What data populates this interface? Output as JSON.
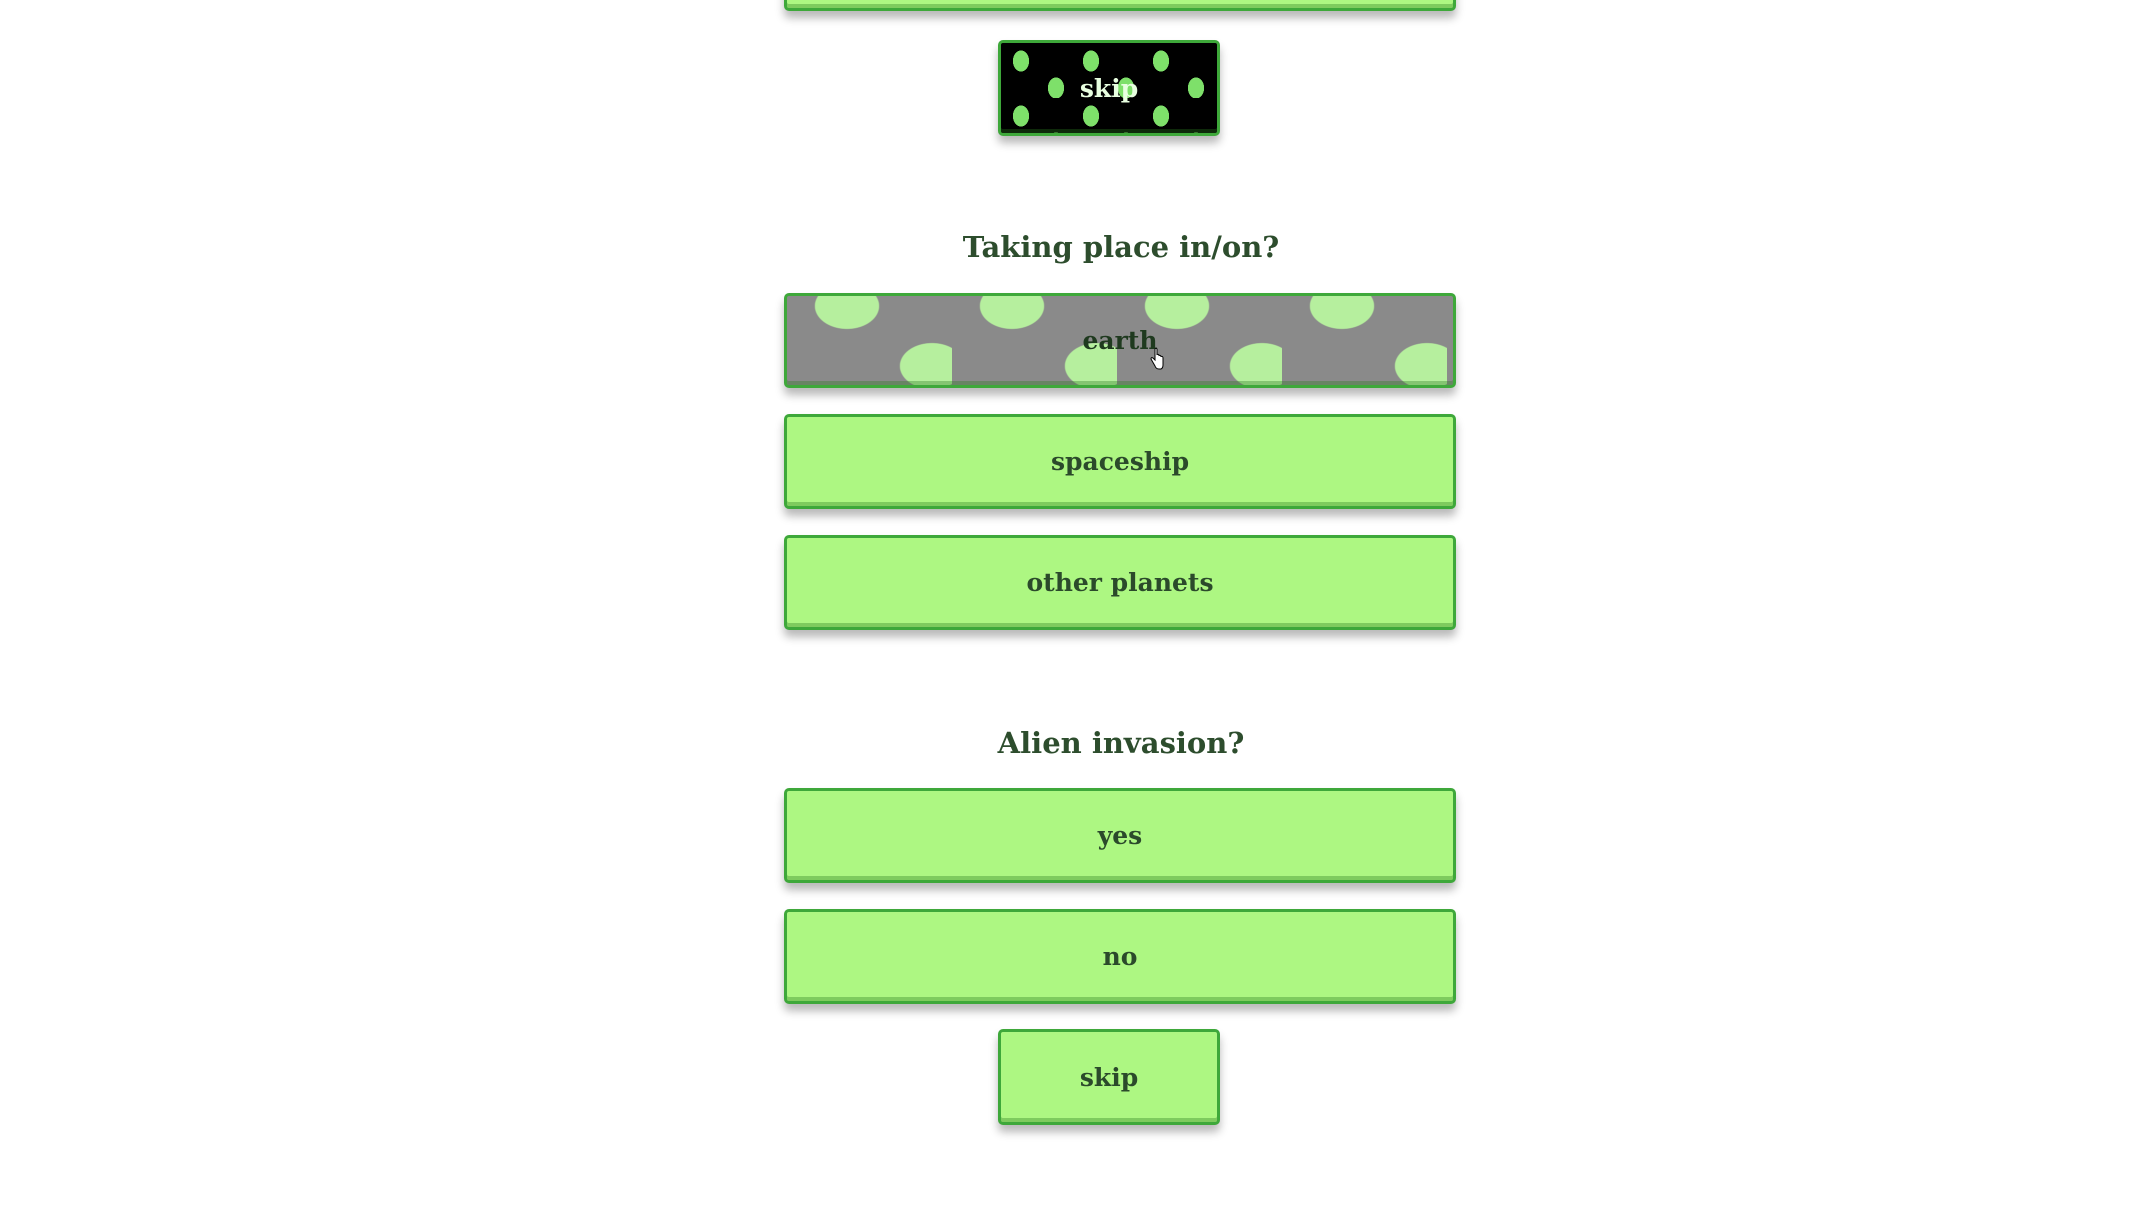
{
  "top_partial_button": {
    "label": ""
  },
  "skip_button_top": {
    "label": "skip"
  },
  "question_location": {
    "title": "Taking place in/on?",
    "options": [
      {
        "label": "earth"
      },
      {
        "label": "spaceship"
      },
      {
        "label": "other planets"
      }
    ]
  },
  "question_invasion": {
    "title": "Alien invasion?",
    "options": [
      {
        "label": "yes"
      },
      {
        "label": "no"
      }
    ],
    "skip_label": "skip"
  },
  "next_question_partial": {
    "title": ""
  },
  "colors": {
    "button_fill": "#adf782",
    "button_border": "#3ea83a",
    "text": "#2d4d2d",
    "pattern_dark_bg": "#000000",
    "pattern_grey_bg": "#8a8a8a"
  },
  "icons": {
    "cursor": "hand-pointer-icon"
  }
}
